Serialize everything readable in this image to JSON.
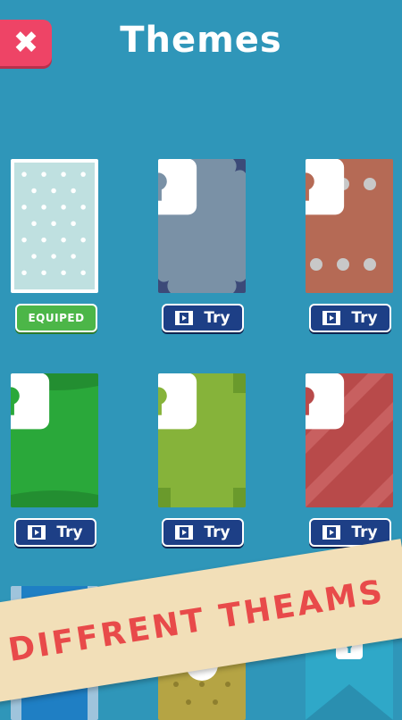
{
  "header": {
    "title": "Themes",
    "close_label": "✖"
  },
  "themes": [
    {
      "button": "EQUIPED",
      "state": "equipped"
    },
    {
      "button": "Try",
      "state": "locked"
    },
    {
      "button": "Try",
      "state": "locked"
    },
    {
      "button": "Try",
      "state": "locked"
    },
    {
      "button": "Try",
      "state": "locked"
    },
    {
      "button": "Try",
      "state": "locked"
    },
    {
      "button": "",
      "state": "locked"
    },
    {
      "button": "",
      "state": "locked"
    },
    {
      "button": "",
      "state": "locked"
    }
  ],
  "banner": {
    "text": "DIFFRENT THEAMS"
  },
  "colors": {
    "background": "#2f96b9",
    "close": "#ee4466",
    "try_button": "#1d3f86",
    "equip_button": "#4cb648",
    "banner": "#f2dfb8",
    "banner_text": "#e84a4a"
  }
}
